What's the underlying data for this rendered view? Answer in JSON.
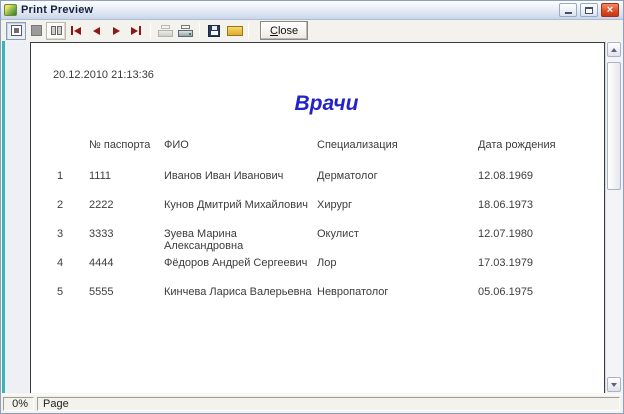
{
  "window": {
    "title": "Print Preview",
    "close_glyph": "×"
  },
  "toolbar": {
    "close_button": {
      "accel": "C",
      "rest": "lose"
    },
    "icons": [
      "zoom-fit",
      "zoom-100",
      "two-pages",
      "first-page",
      "prev-page",
      "next-page",
      "last-page",
      "printer-setup",
      "print",
      "save",
      "open"
    ]
  },
  "report": {
    "timestamp": "20.12.2010 21:13:36",
    "title": "Врачи",
    "columns": [
      "№ паспорта",
      "ФИО",
      "Специализация",
      "Дата рождения"
    ],
    "rows": [
      {
        "num": "1",
        "passport": "1111",
        "fio": "Иванов Иван Иванович",
        "spec": "Дерматолог",
        "birth": "12.08.1969"
      },
      {
        "num": "2",
        "passport": "2222",
        "fio": "Кунов Дмитрий Михайлович",
        "spec": "Хирург",
        "birth": "18.06.1973"
      },
      {
        "num": "3",
        "passport": "3333",
        "fio": "Зуева Марина Александровна",
        "spec": "Окулист",
        "birth": "12.07.1980"
      },
      {
        "num": "4",
        "passport": "4444",
        "fio": "Фёдоров Андрей Сергеевич",
        "spec": "Лор",
        "birth": "17.03.1979"
      },
      {
        "num": "5",
        "passport": "5555",
        "fio": "Кинчева Лариса Валерьевна",
        "spec": "Невропатолог",
        "birth": "05.06.1975"
      }
    ]
  },
  "statusbar": {
    "zoom": "0%",
    "page_label": "Page"
  },
  "colors": {
    "title_blue": "#2323c8",
    "nav_arrow_maroon": "#8c1818",
    "teal_edge": "#38b6b6",
    "close_window_red": "#dd4a22"
  }
}
